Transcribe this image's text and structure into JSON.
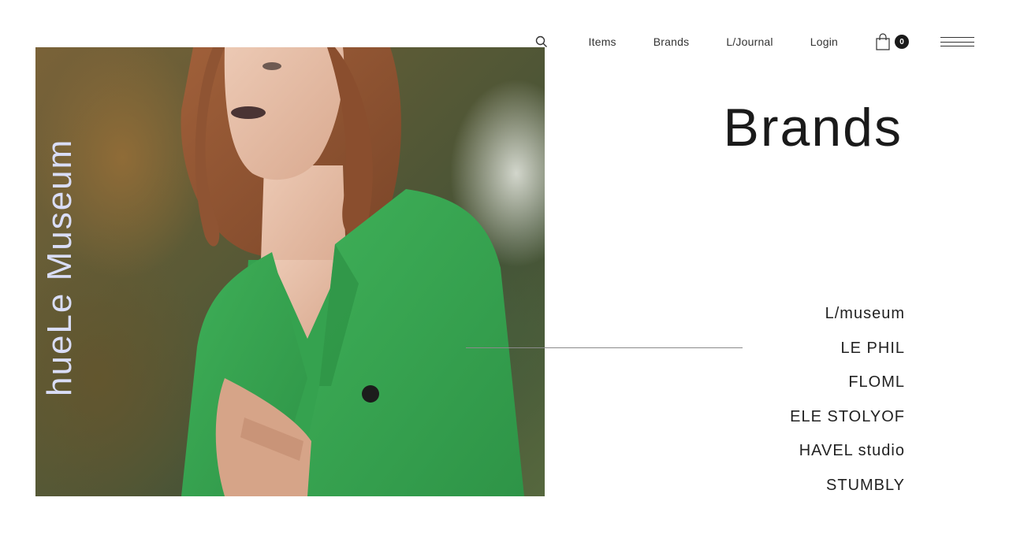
{
  "header": {
    "search_icon": "search-icon",
    "nav_items": [
      "Items",
      "Brands",
      "L/Journal",
      "Login"
    ],
    "cart": {
      "icon": "shopping-bag-icon",
      "count": "0"
    },
    "menu_icon": "hamburger-menu-icon"
  },
  "hero": {
    "vertical_title": "hueLe Museum",
    "vertical_title_color": "#d9ddf7",
    "image": "fashion-model-green-jacket"
  },
  "main": {
    "title": "Brands",
    "brands": [
      "L/museum",
      "LE PHIL",
      "FLOML",
      "ELE STOLYOF",
      "HAVEL studio",
      "STUMBLY"
    ]
  }
}
